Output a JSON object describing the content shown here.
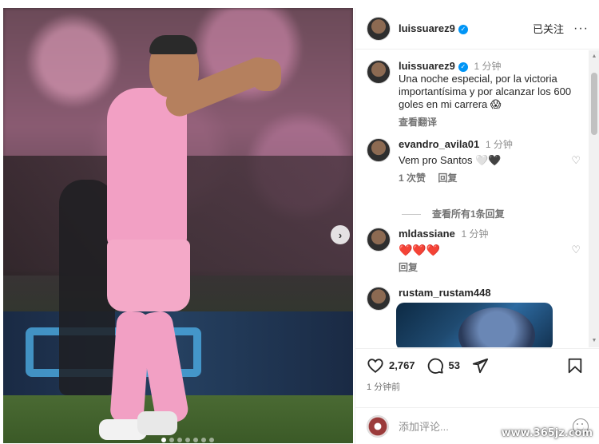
{
  "post": {
    "username": "luissuarez9",
    "follow_label": "已关注",
    "more_label": "···",
    "caption": {
      "username": "luissuarez9",
      "time": "1 分钟",
      "text": "Una noche especial, por la victoria importantísima y por alcanzar los 600 goles en mi carrera 😱",
      "see_translation": "查看翻译"
    }
  },
  "comments": [
    {
      "username": "evandro_avila01",
      "time": "1 分钟",
      "text": "Vem pro Santos 🤍🖤",
      "likes": "1 次赞",
      "reply": "回复",
      "view_replies": "查看所有1条回复"
    },
    {
      "username": "mldassiane",
      "time": "1 分钟",
      "text": "❤️❤️❤️",
      "reply": "回复"
    },
    {
      "username": "rustam_rustam448"
    }
  ],
  "actions": {
    "likes": "2,767",
    "comments": "53",
    "posted": "1 分钟前"
  },
  "add_comment": {
    "placeholder": "添加评论..."
  },
  "watermark": "www.365jz.com",
  "colors": {
    "verified": "#0095f6",
    "jersey_pink": "#f2a0c4",
    "heart_red": "#ed4956"
  },
  "icons": [
    "verified-badge-icon",
    "heart-icon",
    "comment-icon",
    "share-icon",
    "save-icon",
    "emoji-icon",
    "chevron-right-icon"
  ]
}
